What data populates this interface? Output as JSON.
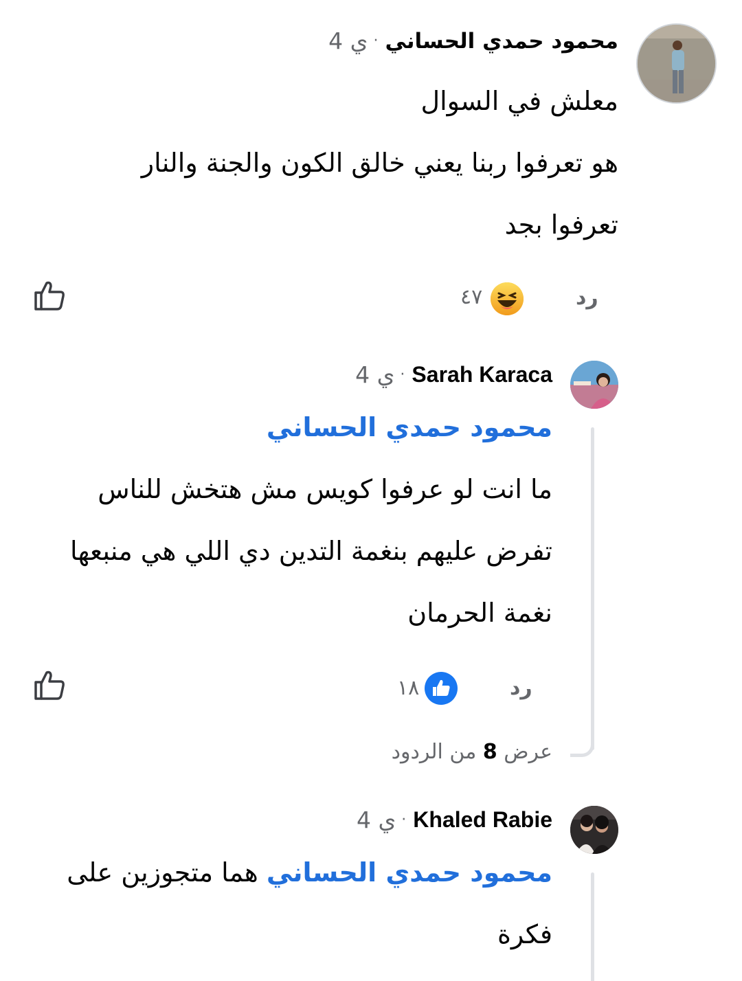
{
  "comments": [
    {
      "author": "محمود حمدي الحساني",
      "time": "4 ي",
      "lines": [
        "معلش في السوال",
        "هو تعرفوا ربنا يعني خالق الكون والجنة والنار",
        "تعرفوا بجد"
      ],
      "reply_label": "رد",
      "reaction": "haha",
      "reaction_count": "٤٧"
    },
    {
      "author": "Sarah Karaca",
      "time": "4 ي",
      "mention": "محمود حمدي الحساني",
      "lines": [
        "ما انت لو عرفوا كويس مش هتخش للناس",
        "تفرض عليهم بنغمة التدين دي اللي هي منبعها",
        "نغمة الحرمان"
      ],
      "reply_label": "رد",
      "reaction": "like",
      "reaction_count": "١٨",
      "view_replies": {
        "prefix": "عرض",
        "count": "8",
        "suffix": "من الردود"
      }
    },
    {
      "author": "Khaled Rabie",
      "time": "4 ي",
      "mention": "محمود حمدي الحساني",
      "first_line_rest": "هما متجوزين على",
      "lines": [
        "فكرة"
      ]
    }
  ],
  "colors": {
    "mention": "#216fdb",
    "meta": "#65676b",
    "like_blue": "#1877f2",
    "haha_yellow": "#f7b125"
  }
}
